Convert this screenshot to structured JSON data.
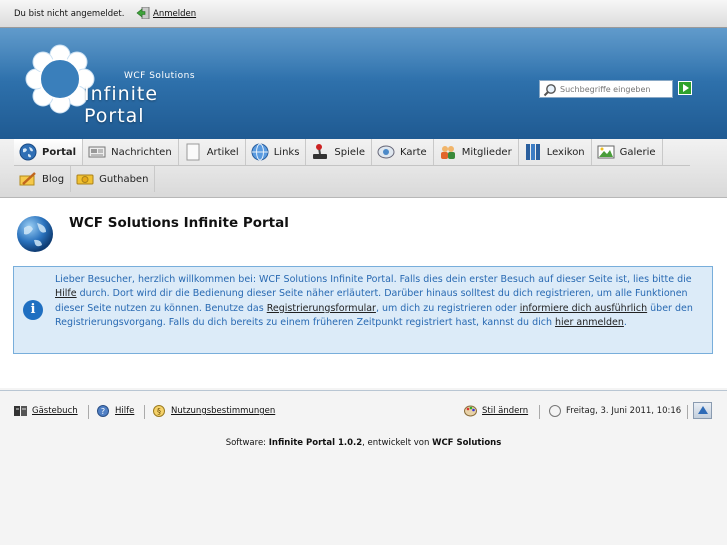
{
  "topbar": {
    "status": "Du bist nicht angemeldet.",
    "login": "Anmelden"
  },
  "logo": {
    "small": "WCF Solutions",
    "big": "Infinite Portal"
  },
  "search": {
    "placeholder": "Suchbegriffe eingeben"
  },
  "nav": {
    "row1": [
      "Portal",
      "Nachrichten",
      "Artikel",
      "Links",
      "Spiele",
      "Karte",
      "Mitglieder",
      "Lexikon",
      "Galerie"
    ],
    "row2": [
      "Blog",
      "Guthaben"
    ]
  },
  "main": {
    "title": "WCF Solutions Infinite Portal",
    "info": {
      "t1": "Lieber Besucher, herzlich willkommen bei: WCF Solutions Infinite Portal. Falls dies dein erster Besuch auf dieser Seite ist, lies bitte die ",
      "l1": "Hilfe",
      "t2": " durch. Dort wird dir die Bedienung dieser Seite näher erläutert. Darüber hinaus solltest du dich registrieren, um alle Funktionen dieser Seite nutzen zu können. Benutze das ",
      "l2": "Registrierungsformular",
      "t3": ", um dich zu registrieren oder ",
      "l3": "informiere dich ausführlich",
      "t4": " über den Registrierungsvorgang. Falls du dich bereits zu einem früheren Zeitpunkt registriert hast, kannst du dich ",
      "l4": "hier anmelden",
      "t5": "."
    }
  },
  "footer": {
    "guestbook": "Gästebuch",
    "help": "Hilfe",
    "terms": "Nutzungsbestimmungen",
    "style": "Stil ändern",
    "date": "Freitag, 3. Juni 2011, 10:16"
  },
  "software": {
    "prefix": "Software: ",
    "product": "Infinite Portal 1.0.2",
    "middle": ", entwickelt von ",
    "vendor": "WCF Solutions"
  },
  "colors": {
    "header": "#2f72ad",
    "info_bg": "#dcebf8",
    "info_text": "#2869b2"
  }
}
